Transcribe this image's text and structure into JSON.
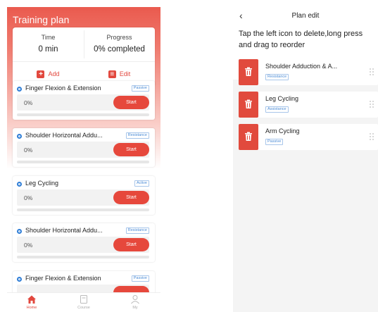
{
  "left": {
    "title": "Training plan",
    "summary": {
      "time_label": "Time",
      "time_value": "0 min",
      "progress_label": "Progress",
      "progress_value": "0% completed",
      "add_label": "Add",
      "edit_label": "Edit"
    },
    "cards": [
      {
        "name": "Finger Flexion & Extension",
        "tag": "Passive",
        "percent": "0%",
        "start": "Start"
      },
      {
        "name": "Shoulder Horizontal Addu...",
        "tag": "Resistance",
        "percent": "0%",
        "start": "Start"
      },
      {
        "name": "Leg Cycling",
        "tag": "Active",
        "percent": "0%",
        "start": "Start"
      },
      {
        "name": "Shoulder Horizontal Addu...",
        "tag": "Resistance",
        "percent": "0%",
        "start": "Start"
      },
      {
        "name": "Finger Flexion & Extension",
        "tag": "Passive",
        "percent": "",
        "start": ""
      }
    ],
    "nav": {
      "home": "Home",
      "course": "Course",
      "my": "My"
    },
    "accent": "#e6483c"
  },
  "right": {
    "back_icon": "chevron-left-icon",
    "title": "Plan edit",
    "hint": "Tap the left icon to delete,long press and drag to reorder",
    "items": [
      {
        "name": "Shoulder Adduction & A...",
        "tag": "Resistance"
      },
      {
        "name": "Leg Cycling",
        "tag": "Assistance"
      },
      {
        "name": "Arm Cycling",
        "tag": "Passive"
      }
    ]
  }
}
